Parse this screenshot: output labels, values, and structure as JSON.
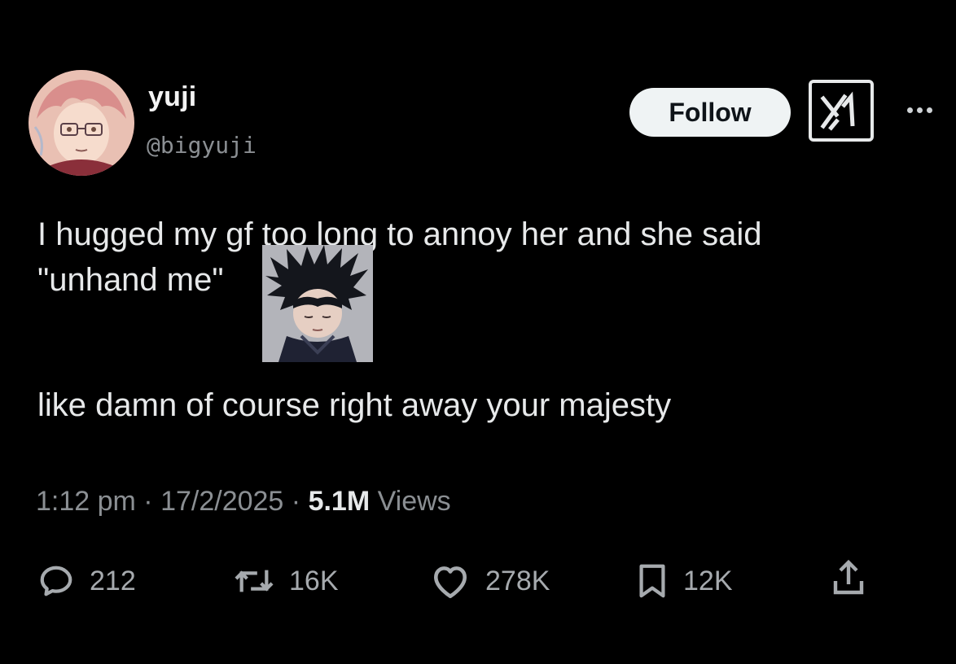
{
  "author": {
    "display_name": "yuji",
    "handle": "@bigyuji",
    "avatar_icon": "avatar-anime-character"
  },
  "header": {
    "follow_label": "Follow",
    "grok_icon": "grok-icon",
    "more_icon": "more-dots-icon"
  },
  "tweet": {
    "line1": "I hugged my gf too long to annoy her and she said",
    "line2": "\"unhand me\"",
    "line3": "like damn of course right away your majesty",
    "sticker_icon": "anime-sticker-image"
  },
  "meta": {
    "time": "1:12 pm",
    "sep1": " · ",
    "date": "17/2/2025",
    "sep2": " · ",
    "views_count": "5.1M",
    "views_label": " Views"
  },
  "actions": {
    "replies": "212",
    "reposts": "16K",
    "likes": "278K",
    "bookmarks": "12K"
  },
  "colors": {
    "background": "#000000",
    "text": "#e7e9ea",
    "secondary": "#8b8f93",
    "follow_bg": "#eff3f4"
  }
}
